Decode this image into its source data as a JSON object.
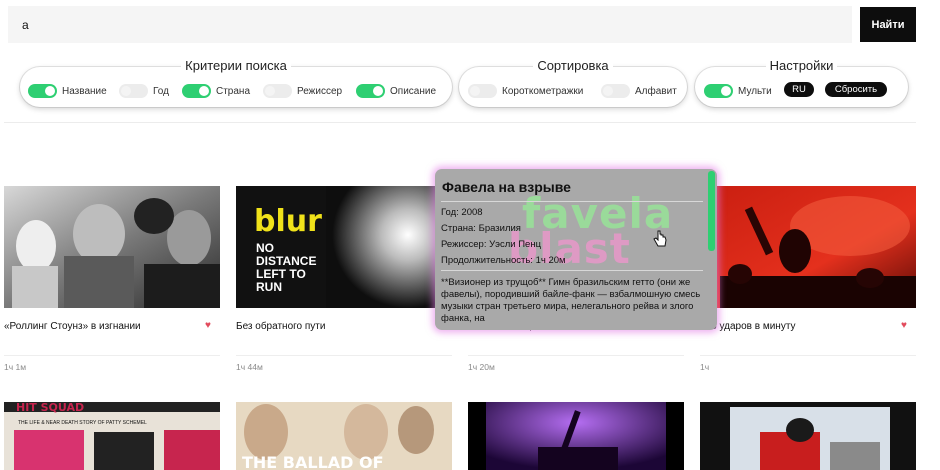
{
  "search": {
    "value": "а",
    "button_label": "Найти"
  },
  "criteria": {
    "title": "Критерии поиска",
    "options": [
      {
        "label": "Название",
        "on": true
      },
      {
        "label": "Год",
        "on": false
      },
      {
        "label": "Страна",
        "on": true
      },
      {
        "label": "Режиссер",
        "on": false
      },
      {
        "label": "Описание",
        "on": true
      }
    ]
  },
  "sorting": {
    "title": "Сортировка",
    "options": [
      {
        "label": "Короткометражки",
        "on": false
      },
      {
        "label": "Алфавит",
        "on": false
      }
    ]
  },
  "settings": {
    "title": "Настройки",
    "multi_label": "Мульти",
    "multi_on": true,
    "lang_label": "RU",
    "reset_label": "Сбросить"
  },
  "movies": [
    {
      "title": "«Роллинг Стоунз» в изгнании",
      "duration": "1ч 1м",
      "favorite": true
    },
    {
      "title": "Без обратного пути",
      "duration": "1ч 44м",
      "favorite": false
    },
    {
      "title": "Фавела на взрыве",
      "duration": "1ч 20м",
      "favorite": false
    },
    {
      "title": "196 ударов в минуту",
      "duration": "1ч",
      "favorite": true
    }
  ],
  "poster_texts": {
    "blur_logo": "blur",
    "blur_line1": "NO",
    "blur_line2": "DISTANCE",
    "blur_line3": "LEFT TO",
    "blur_line4": "RUN",
    "row2_a": "HIT SQUAD",
    "row2_b": "THE LIFE & NEAR DEATH STORY OF PATTY SCHEMEL",
    "row2_c": "THE BALLAD OF"
  },
  "tooltip": {
    "title": "Фавела на взрыве",
    "year": "Год: 2008",
    "country": "Страна: Бразилия",
    "director": "Режиссер: Уэсли Пенц",
    "duration": "Продолжительность: 1ч 20м",
    "description": "**Визионер из трущоб** Гимн бразильским гетто (они же фавелы), породивший байле-фанк — взбалмошную смесь музыки стран третьего мира, нелегального рейва и злого фанка, на",
    "overlay_line1": "favela",
    "overlay_line2": "blast"
  },
  "colors": {
    "accent_green": "#2ecf72",
    "heart": "#e24b5c",
    "tooltip_glow": "#e278e6"
  }
}
